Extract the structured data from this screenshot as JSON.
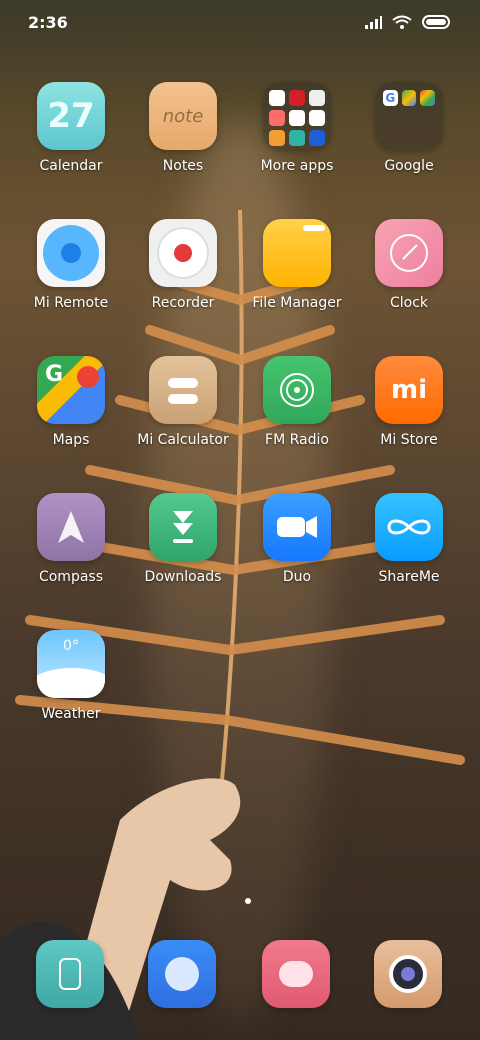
{
  "status_bar": {
    "time": "2:36"
  },
  "apps": [
    {
      "label": "Calendar",
      "icon": "calendar-icon",
      "icon_text": "27"
    },
    {
      "label": "Notes",
      "icon": "notes-icon",
      "icon_text": "note"
    },
    {
      "label": "More apps",
      "icon": "folder-icon"
    },
    {
      "label": "Google",
      "icon": "folder-icon"
    },
    {
      "label": "Mi Remote",
      "icon": "remote-icon"
    },
    {
      "label": "Recorder",
      "icon": "recorder-icon"
    },
    {
      "label": "File Manager",
      "icon": "folder-icon"
    },
    {
      "label": "Clock",
      "icon": "clock-icon"
    },
    {
      "label": "Maps",
      "icon": "maps-icon"
    },
    {
      "label": "Mi Calculator",
      "icon": "calculator-icon"
    },
    {
      "label": "FM Radio",
      "icon": "radio-icon"
    },
    {
      "label": "Mi Store",
      "icon": "store-icon",
      "icon_text": "mi"
    },
    {
      "label": "Compass",
      "icon": "compass-icon"
    },
    {
      "label": "Downloads",
      "icon": "download-icon"
    },
    {
      "label": "Duo",
      "icon": "video-icon"
    },
    {
      "label": "ShareMe",
      "icon": "share-icon"
    },
    {
      "label": "Weather",
      "icon": "weather-icon",
      "icon_text": "0°"
    }
  ],
  "dock": [
    {
      "icon": "phone-icon"
    },
    {
      "icon": "browser-icon"
    },
    {
      "icon": "messages-icon"
    },
    {
      "icon": "camera-icon"
    }
  ]
}
